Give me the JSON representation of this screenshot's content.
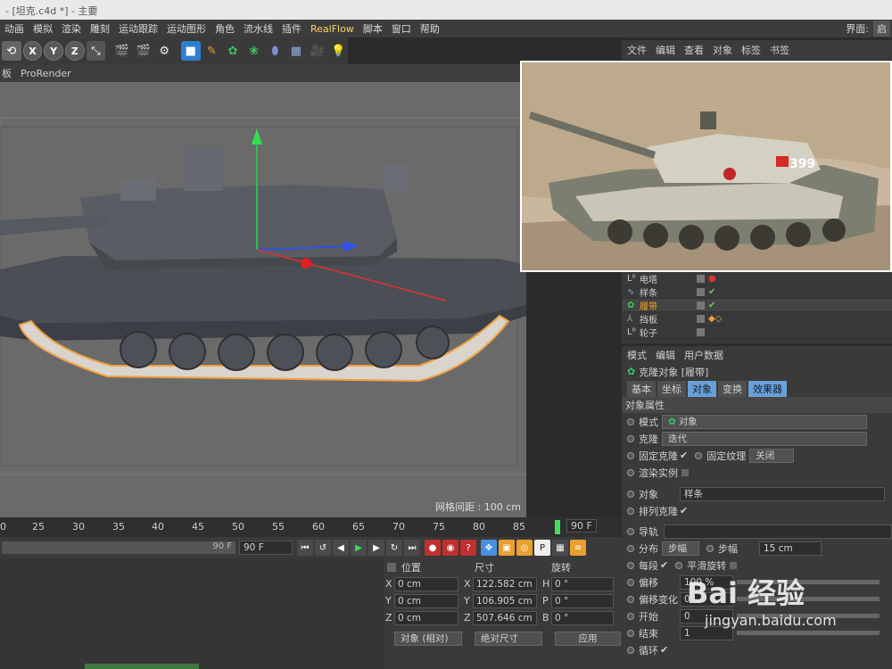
{
  "window": {
    "title": "- [坦克.c4d *] - 主要"
  },
  "menu": {
    "items": [
      "动画",
      "模拟",
      "渲染",
      "雕刻",
      "运动跟踪",
      "运动图形",
      "角色",
      "流水线",
      "插件",
      "RealFlow",
      "脚本",
      "窗口",
      "帮助"
    ],
    "layout_label": "界面:",
    "layout_value": "启"
  },
  "toolbar": {
    "axis_x": "X",
    "axis_y": "Y",
    "axis_z": "Z"
  },
  "viewport": {
    "tabs": [
      "板",
      "ProRender"
    ],
    "grid_spacing": "网格间距 : 100 cm"
  },
  "object_manager": {
    "menu": [
      "文件",
      "编辑",
      "查看",
      "对象",
      "标签",
      "书签"
    ],
    "items": [
      {
        "name": "电塔",
        "selected": false,
        "tag": "red"
      },
      {
        "name": "样条",
        "selected": false,
        "tag": "check"
      },
      {
        "name": "履带",
        "selected": true,
        "tag": "check"
      },
      {
        "name": "挡板",
        "selected": false,
        "tag": "pattern"
      },
      {
        "name": "轮子",
        "selected": false,
        "tag": "none"
      }
    ]
  },
  "attributes": {
    "menu": [
      "模式",
      "编辑",
      "用户数据"
    ],
    "object_title": "克隆对象 [履带]",
    "tabs": [
      "基本",
      "坐标",
      "对象",
      "变换",
      "效果器"
    ],
    "active_tabs": [
      "对象",
      "效果器"
    ],
    "section": "对象属性",
    "mode_label": "模式",
    "mode_value": "对象",
    "clone_label": "克隆",
    "clone_value": "迭代",
    "fixed_clone": "固定克隆",
    "fixed_texture": "固定纹理",
    "fixed_texture_value": "关闭",
    "render_instances": "渲染实例",
    "object_label": "对象",
    "object_value": "样条",
    "arrange_clones": "排列克隆",
    "rail_label": "导轨",
    "distribution_label": "分布",
    "distribution_value": "步幅",
    "step_label": "步幅",
    "step_value": "15 cm",
    "per_segment": "每段",
    "smooth_rotation": "平滑旋转",
    "offset_label": "偏移",
    "offset_value": "100 %",
    "offset_variation": "偏移变化",
    "offset_variation_value": "0",
    "start_label": "开始",
    "start_value": "0",
    "end_label": "结束",
    "end_value": "1",
    "loop_label": "循环"
  },
  "timeline": {
    "ticks": [
      "0",
      "25",
      "30",
      "35",
      "40",
      "45",
      "50",
      "55",
      "60",
      "65",
      "70",
      "75",
      "80",
      "85"
    ],
    "end_frame": "90 F",
    "current_end": "90 F",
    "range_end": "90 F"
  },
  "coordinates": {
    "headers": [
      "位置",
      "尺寸",
      "旋转"
    ],
    "rows": [
      {
        "axis": "X",
        "pos": "0 cm",
        "size_axis": "X",
        "size": "122.582 cm",
        "rot_axis": "H",
        "rot": "0 °"
      },
      {
        "axis": "Y",
        "pos": "0 cm",
        "size_axis": "Y",
        "size": "106.905 cm",
        "rot_axis": "P",
        "rot": "0 °"
      },
      {
        "axis": "Z",
        "pos": "0 cm",
        "size_axis": "Z",
        "size": "507.646 cm",
        "rot_axis": "B",
        "rot": "0 °"
      }
    ],
    "mode_dropdown": "对象 (相对)",
    "size_dropdown": "绝对尺寸",
    "apply_button": "应用"
  },
  "photo": {
    "turret_number": "399"
  },
  "watermark": {
    "brand": "Bai 经验",
    "url": "jingyan.baidu.com"
  },
  "colors": {
    "accent_blue": "#6aa0d8",
    "selected_orange": "#f5a623",
    "realflow_yellow": "#ffd26a"
  }
}
